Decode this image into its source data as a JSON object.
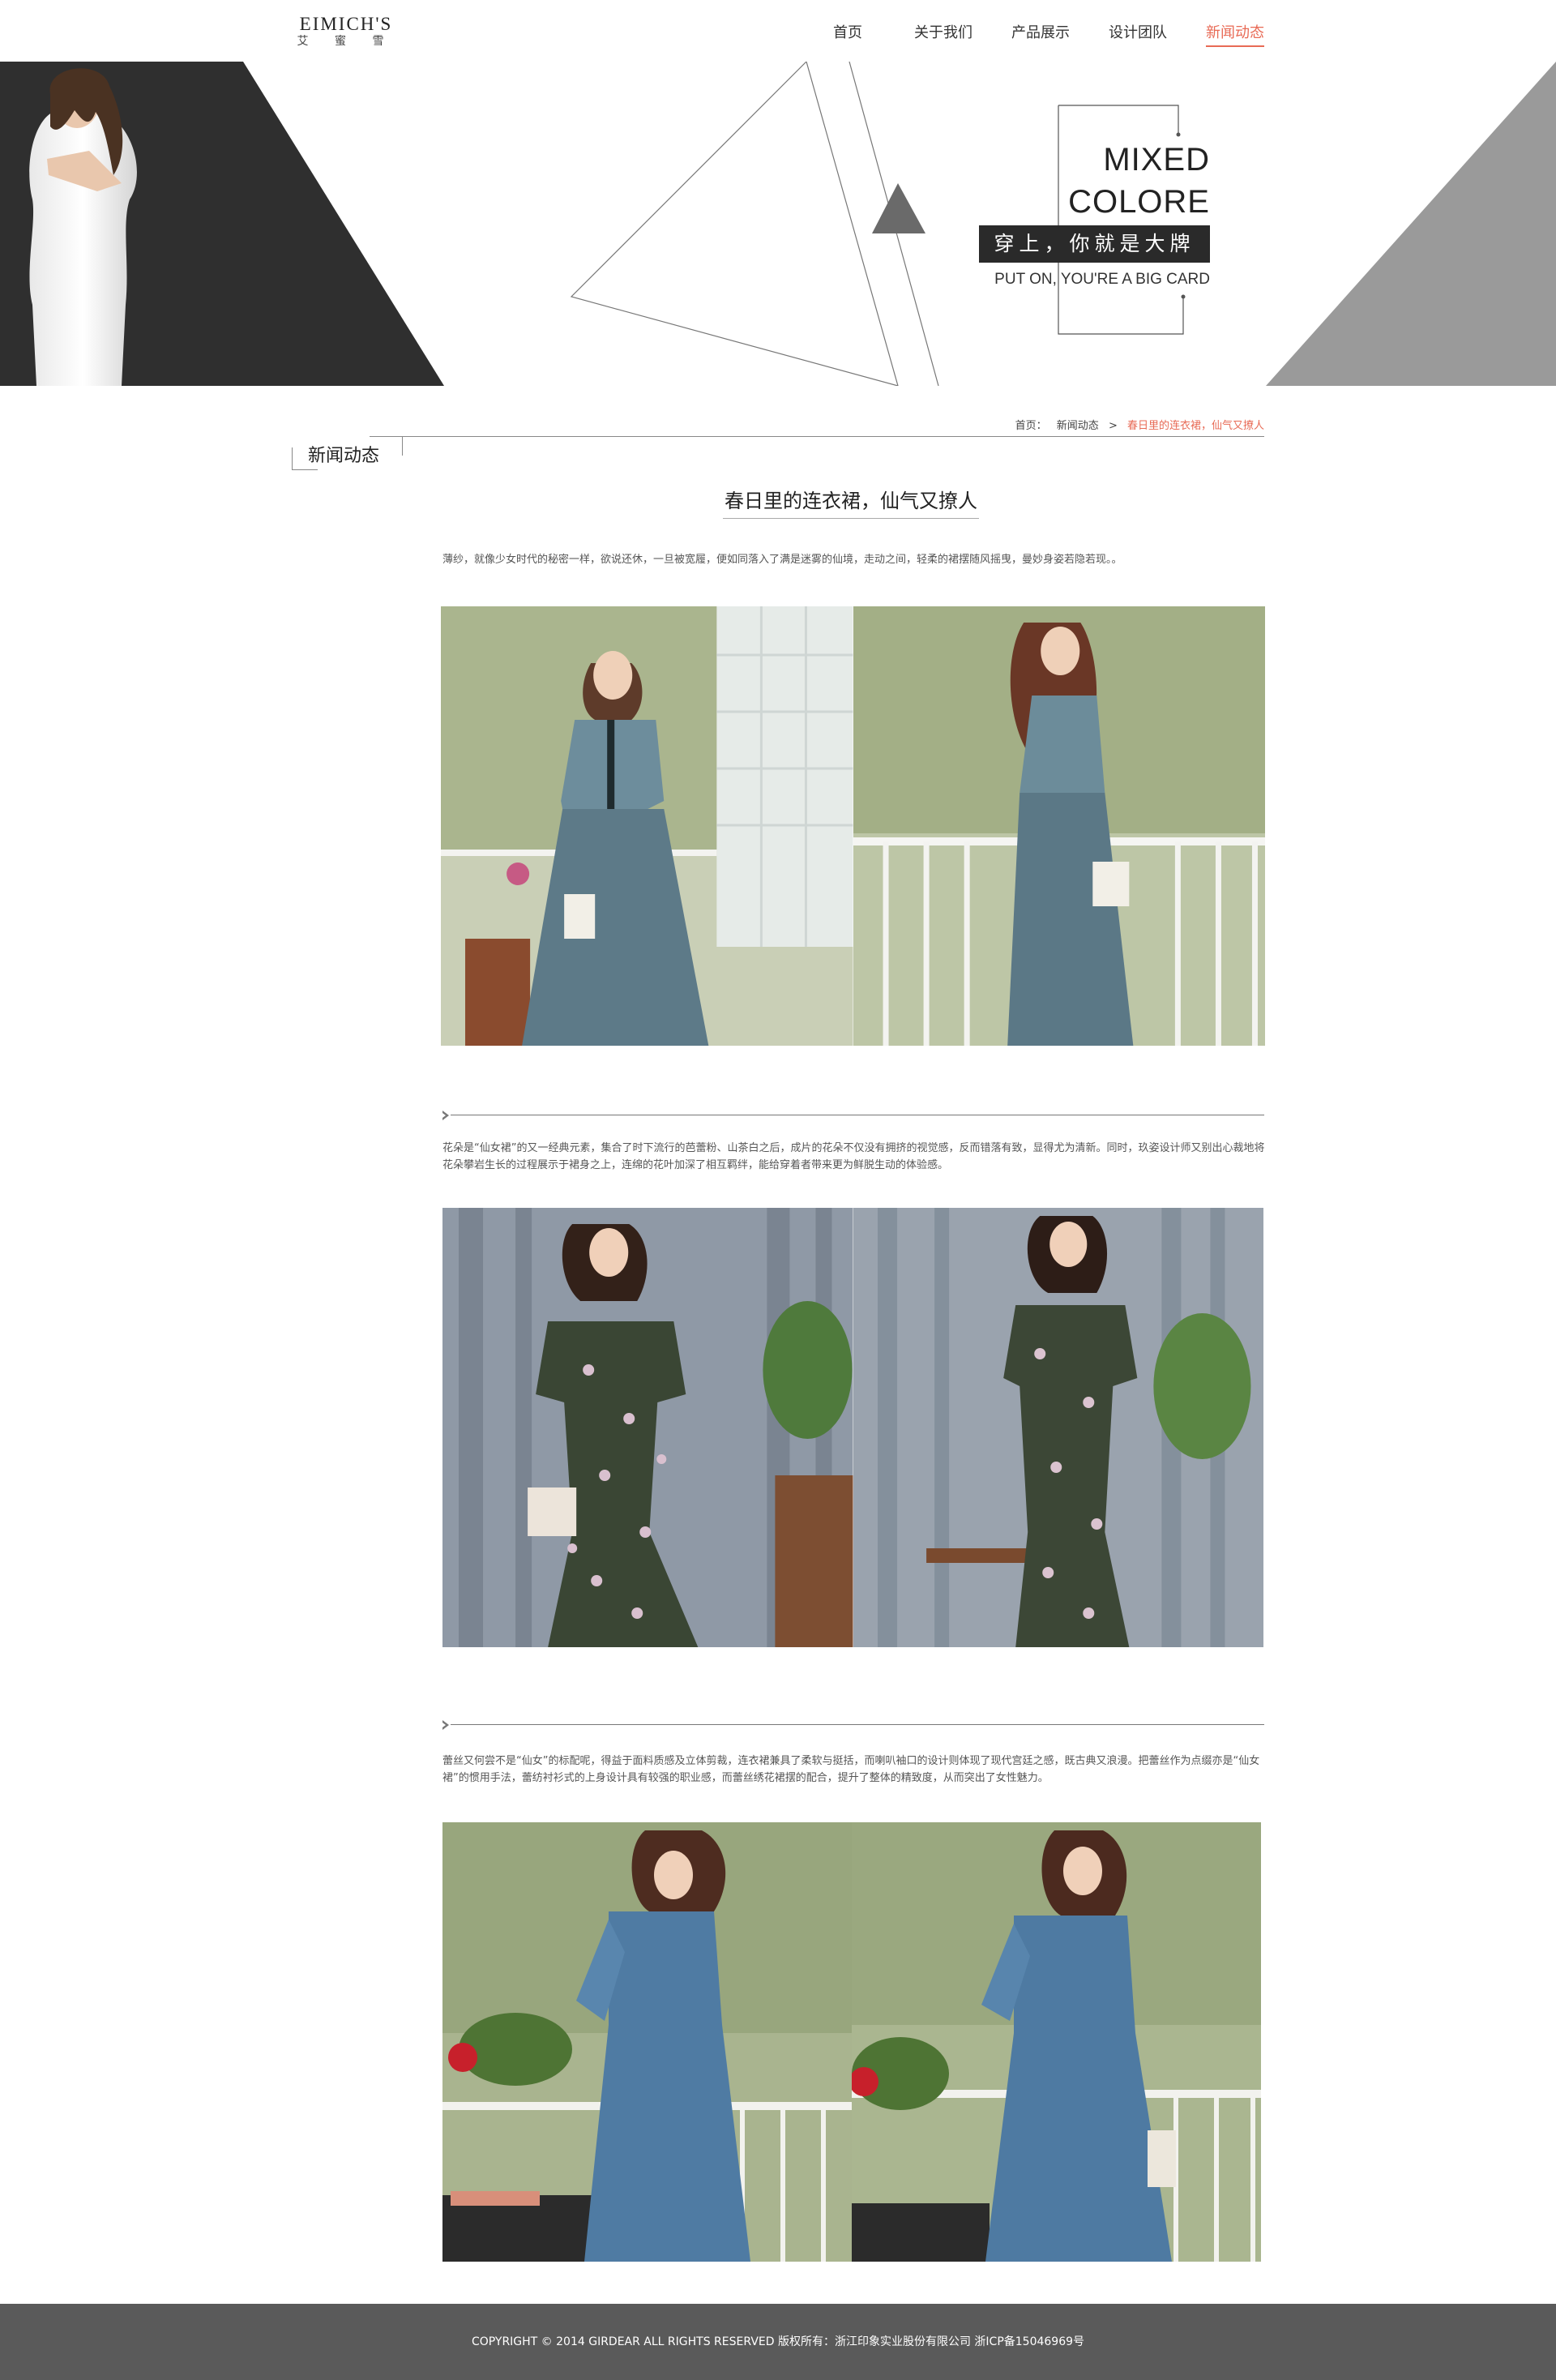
{
  "header": {
    "logo": {
      "main": "EIMICH'S",
      "sub": "艾 蜜 雪"
    },
    "nav": [
      {
        "label": "首页"
      },
      {
        "label": "关于我们"
      },
      {
        "label": "产品展示"
      },
      {
        "label": "设计团队"
      },
      {
        "label": "新闻动态"
      }
    ],
    "active_nav": "新闻动态"
  },
  "banner": {
    "title_line1": "MIXED",
    "title_line2": "COLORE",
    "slogan": "穿上，你就是大牌",
    "slogan_en": "PUT ON, YOU'RE A BIG CARD"
  },
  "breadcrumb": {
    "home": "首页：",
    "section": "新闻动态",
    "separator": ">",
    "current": "春日里的连衣裙，仙气又撩人"
  },
  "section_label": "新闻动态",
  "article": {
    "title": "春日里的连衣裙，仙气又撩人",
    "intro": "薄纱，就像少女时代的秘密一样，欲说还休，一旦被宽履，便如同落入了满是迷雾的仙境，走动之间，轻柔的裙摆随风摇曳，曼妙身姿若隐若现。。",
    "para2": "花朵是“仙女裙”的又一经典元素，集合了时下流行的芭蕾粉、山茶白之后，成片的花朵不仅没有拥挤的视觉感，反而错落有致，显得尤为清新。同时，玖姿设计师又别出心裁地将花朵攀岩生长的过程展示于裙身之上，连绵的花叶加深了相互羁绊，能给穿着者带来更为鲜脱生动的体验感。",
    "para3": "蕾丝又何尝不是“仙女”的标配呢，得益于面料质感及立体剪裁，连衣裙兼具了柔软与挺括，而喇叭袖口的设计则体现了现代宫廷之感，既古典又浪漫。把蕾丝作为点缀亦是“仙女裙”的惯用手法，蕾纺衬衫式的上身设计具有较强的职业感，而蕾丝绣花裙摆的配合，提升了整体的精致度，从而突出了女性魅力。"
  },
  "colors": {
    "accent": "#e86a55",
    "dark": "#2f2f2f",
    "gray": "#9a9a9a",
    "footer_bg": "#5a5a5a"
  },
  "footer": {
    "text": "COPYRIGHT © 2014 GIRDEAR ALL RIGHTS RESERVED 版权所有：浙江印象实业股份有限公司  浙ICP备15046969号"
  }
}
